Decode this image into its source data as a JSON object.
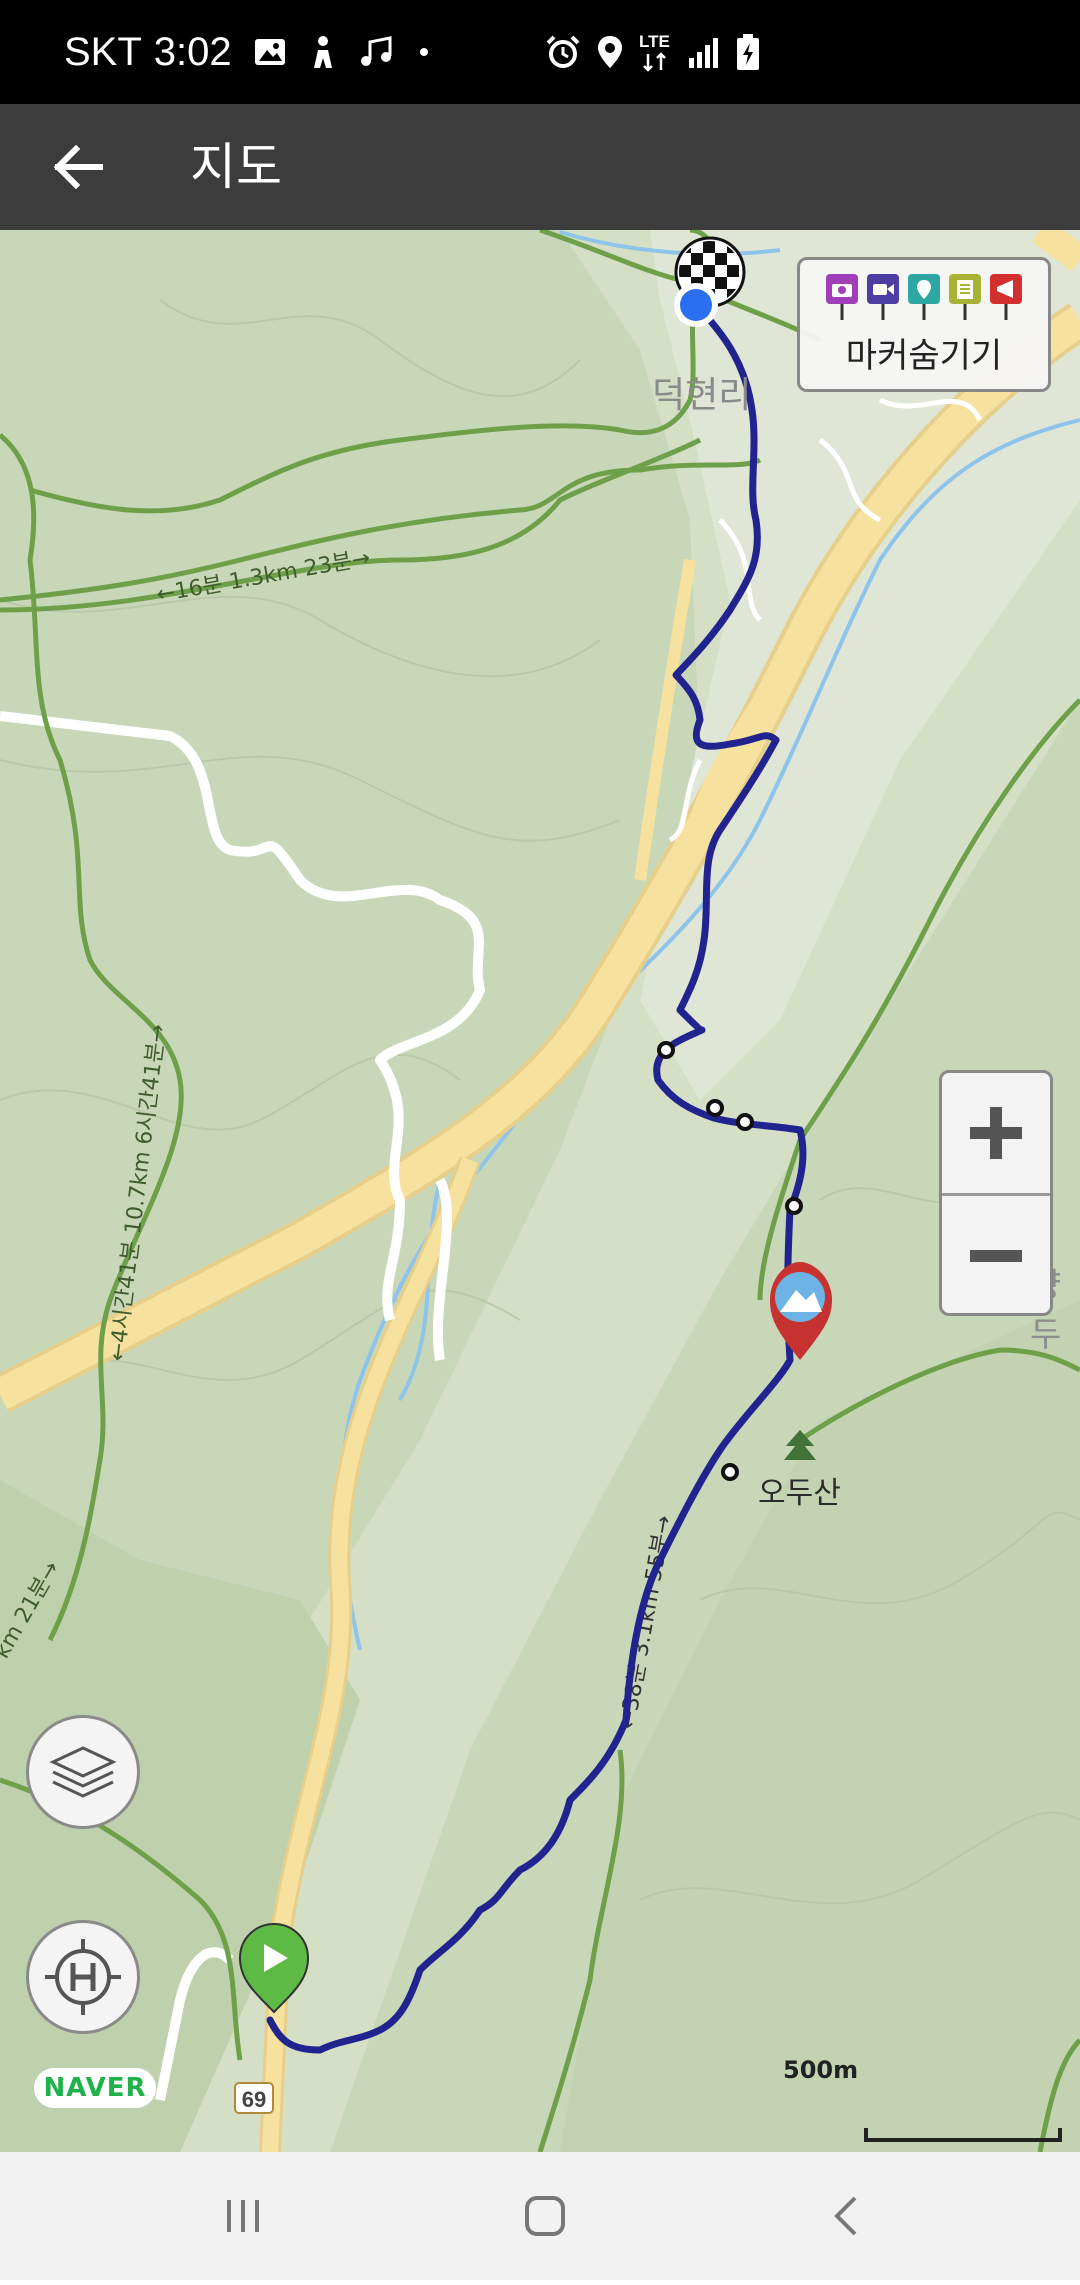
{
  "status_bar": {
    "carrier": "SKT",
    "time": "3:02",
    "network": "LTE",
    "icons": [
      "image-icon",
      "figure-icon",
      "music-icon",
      "dot-icon",
      "alarm-icon",
      "location-icon",
      "lte-icon",
      "signal-icon",
      "battery-charging-icon"
    ]
  },
  "app_bar": {
    "back_icon": "arrow-left-icon",
    "title": "지도"
  },
  "map": {
    "provider": "NAVER",
    "places": {
      "deokhyeon": "덕현리",
      "odusan": "오두산",
      "edge_label": "양두"
    },
    "trail_labels": {
      "top": "←16분 1.3km 23분→",
      "left": "←4시간41분 10.7km 6시간41분→",
      "left_edge": "km 21분→",
      "route": "←38분 3.1km 55분→"
    },
    "road_number": "69",
    "scale": "500m",
    "colors": {
      "route": "#21238f",
      "trail": "#6ea04a",
      "highway": "#f6e29e",
      "water": "#8ec3ea",
      "land": "#c9d7b9",
      "current_location": "#2a6ff0",
      "start_marker": "#5dbb45",
      "summit_marker": "#c5322f"
    }
  },
  "marker_panel": {
    "label": "마커숨기기",
    "icons": [
      "camera-icon",
      "video-icon",
      "pin-icon",
      "note-icon",
      "megaphone-icon"
    ],
    "icon_colors": [
      "#a13fb8",
      "#4b3fa3",
      "#2ca7a3",
      "#a8b235",
      "#d1302f"
    ]
  },
  "zoom": {
    "in_icon": "plus-icon",
    "out_icon": "minus-icon"
  },
  "controls": {
    "layers_icon": "layers-icon",
    "location_icon": "helipad-target-icon"
  },
  "nav_bar": {
    "icons": [
      "recent-apps-icon",
      "home-icon",
      "back-chevron-icon"
    ]
  }
}
